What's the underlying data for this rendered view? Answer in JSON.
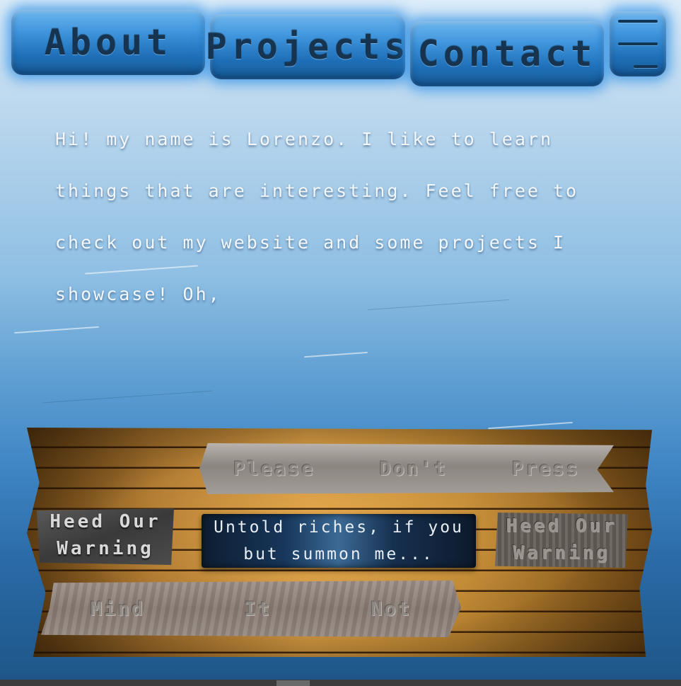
{
  "nav": {
    "about": "About",
    "projects": "Projects",
    "contact": "Contact",
    "menu_icon": "hamburger-menu-icon"
  },
  "intro": {
    "text": "Hi! my name is Lorenzo. I like to learn things that are interesting.  Feel free to check out my website and some projects I showcase!   Oh,"
  },
  "sign": {
    "top_banner": [
      "Please",
      "Don't",
      "Press"
    ],
    "left_plaque": "Heed Our Warning",
    "right_plaque": "Heed Our Warning",
    "center_button": "Untold riches, if you but summon me...",
    "bottom_banner": [
      "Mind",
      "It",
      "Not"
    ]
  },
  "colors": {
    "nav_glow": "#288ce6",
    "nav_text": "#16344f",
    "intro_text": "#f4f8fc"
  }
}
